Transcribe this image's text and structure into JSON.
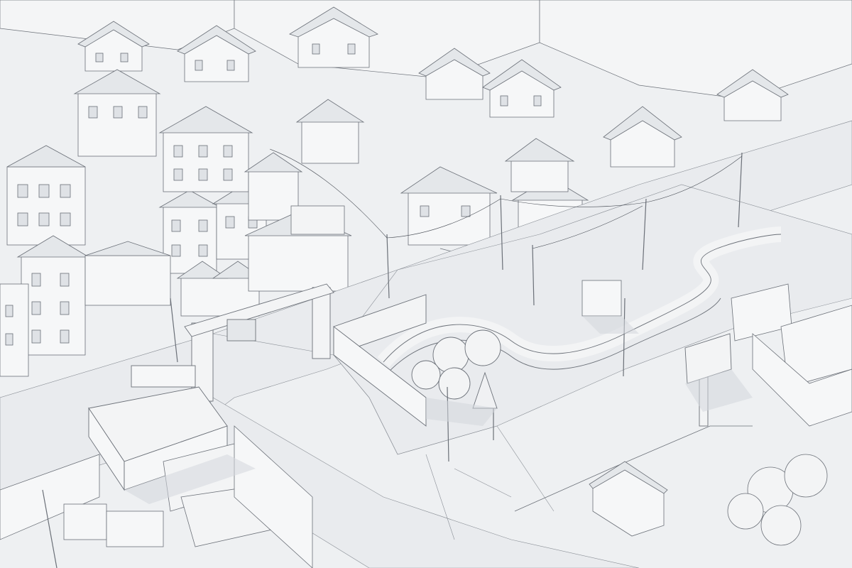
{
  "scene": {
    "kind": "isometric wireframe town render",
    "colors": {
      "ground": "#eef0f2",
      "road": "#e9ebee",
      "wall": "#f6f7f8",
      "roof": "#e4e7ea",
      "shadow": "#d3d7dc",
      "line": "#6b7078",
      "billboard": "#f3f4f5"
    }
  }
}
